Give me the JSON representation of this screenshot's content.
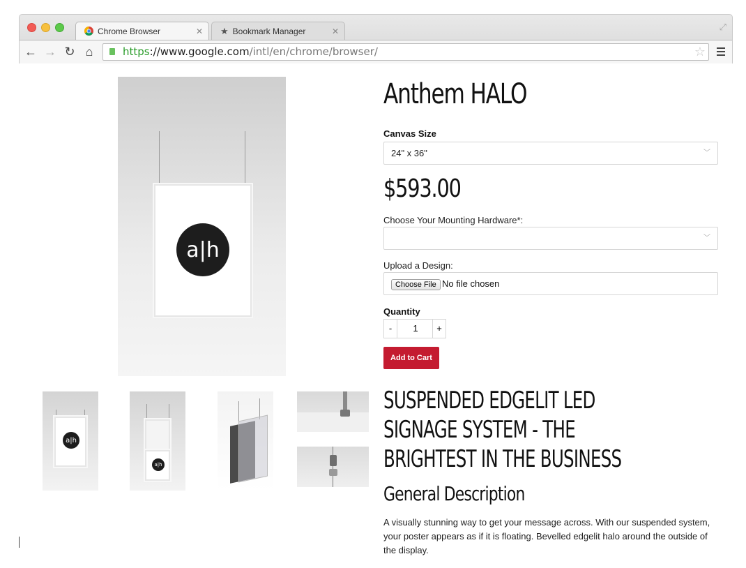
{
  "browser": {
    "tabs": [
      {
        "label": "Chrome Browser",
        "icon": "chrome-logo-icon"
      },
      {
        "label": "Bookmark Manager",
        "icon": "star-icon"
      }
    ],
    "url_scheme": "https",
    "url_sep": "://",
    "url_host": "www.google.com",
    "url_path": "/intl/en/chrome/browser/"
  },
  "product": {
    "title": "Anthem HALO",
    "canvas_size_label": "Canvas Size",
    "canvas_size_value": "24\" x 36\"",
    "price": "$593.00",
    "mounting_label": "Choose Your Mounting Hardware*:",
    "mounting_value": "",
    "upload_label": "Upload a Design:",
    "choose_file_label": "Choose File",
    "file_status": "No file chosen",
    "quantity_label": "Quantity",
    "qty_minus": "-",
    "quantity_value": "1",
    "qty_plus": "+",
    "add_to_cart_label": "Add to Cart",
    "logo_text": "a|h"
  },
  "content": {
    "headline": "SUSPENDED EDGELIT LED SIGNAGE SYSTEM - THE BRIGHTEST IN THE BUSINESS",
    "subheading": "General Description",
    "description": "A visually stunning way to get your message across. With our suspended system, your poster appears as if it is floating. Bevelled edgelit halo around the outside of the display."
  }
}
